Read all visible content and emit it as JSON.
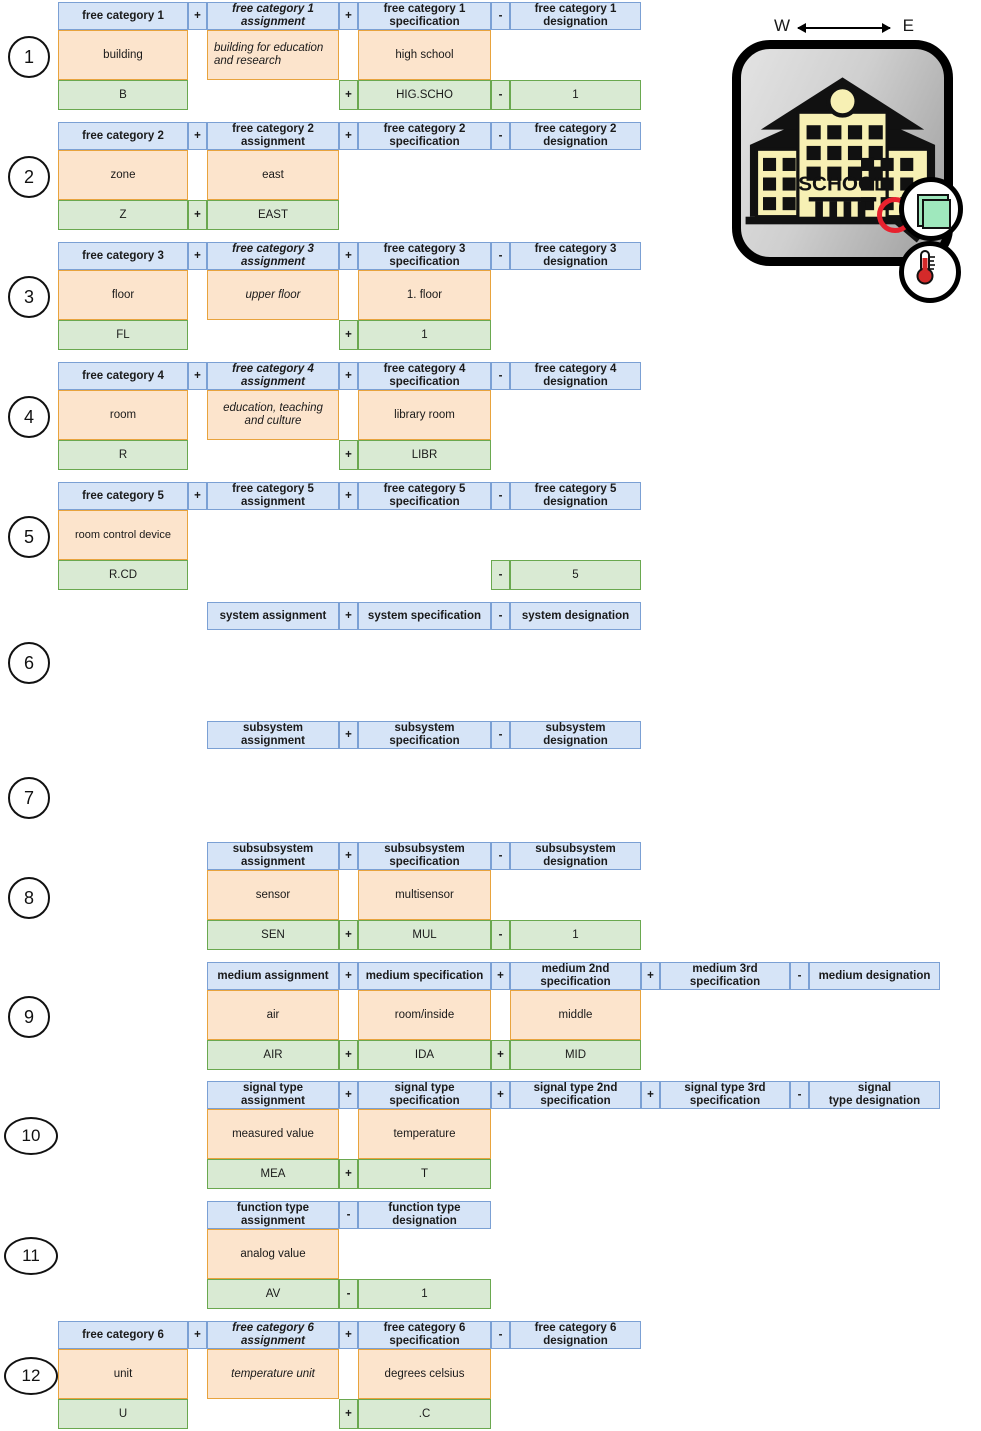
{
  "illustration": {
    "west_label": "W",
    "east_label": "E",
    "building_label": "SCHOOL",
    "badges": [
      {
        "name": "green-square-badge",
        "meaning": "room"
      },
      {
        "name": "thermometer-badge",
        "meaning": "temperature"
      }
    ],
    "magnifier": "magnifier-icon"
  },
  "blocks": [
    {
      "index": "1",
      "headers": [
        "free category 1",
        "+",
        "free category 1\nassignment",
        "+",
        "free category 1\nspecification",
        "-",
        "free category 1\ndesignation"
      ],
      "header_italic": [
        false,
        false,
        true,
        false,
        false,
        false,
        false
      ],
      "values": {
        "category": "building",
        "assignment": "building for education and research",
        "specification": "high school",
        "designation": ""
      },
      "value_italic": {
        "category": false,
        "assignment": true,
        "specification": false
      },
      "codes": {
        "category": "B",
        "op1": "",
        "assignment": "",
        "op2": "+",
        "specification": "HIG.SCHO",
        "op3": "-",
        "designation": "1"
      }
    },
    {
      "index": "2",
      "headers": [
        "free category 2",
        "+",
        "free category 2\nassignment",
        "+",
        "free category 2\nspecification",
        "-",
        "free category 2\ndesignation"
      ],
      "header_italic": [
        false,
        false,
        false,
        false,
        false,
        false,
        false
      ],
      "values": {
        "category": "zone",
        "assignment": "east",
        "specification": "",
        "designation": ""
      },
      "value_italic": {
        "category": false,
        "assignment": false,
        "specification": false
      },
      "codes": {
        "category": "Z",
        "op1": "+",
        "assignment": "EAST",
        "op2": "",
        "specification": "",
        "op3": "",
        "designation": ""
      }
    },
    {
      "index": "3",
      "headers": [
        "free category 3",
        "+",
        "free category 3\nassignment",
        "+",
        "free category 3\nspecification",
        "-",
        "free category 3\ndesignation"
      ],
      "header_italic": [
        false,
        false,
        true,
        false,
        false,
        false,
        false
      ],
      "values": {
        "category": "floor",
        "assignment": "upper floor",
        "specification": "1. floor",
        "designation": ""
      },
      "value_italic": {
        "category": false,
        "assignment": true,
        "specification": false
      },
      "codes": {
        "category": "FL",
        "op1": "",
        "assignment": "",
        "op2": "+",
        "specification": "1",
        "op3": "",
        "designation": ""
      }
    },
    {
      "index": "4",
      "headers": [
        "free category 4",
        "+",
        "free category 4\nassignment",
        "+",
        "free category 4\nspecification",
        "-",
        "free category 4\ndesignation"
      ],
      "header_italic": [
        false,
        false,
        true,
        false,
        false,
        false,
        false
      ],
      "values": {
        "category": "room",
        "assignment": "education, teaching and culture",
        "specification": "library room",
        "designation": ""
      },
      "value_italic": {
        "category": false,
        "assignment": true,
        "specification": false
      },
      "codes": {
        "category": "R",
        "op1": "",
        "assignment": "",
        "op2": "+",
        "specification": "LIBR",
        "op3": "",
        "designation": ""
      }
    },
    {
      "index": "5",
      "headers": [
        "free category 5",
        "+",
        "free category 5\nassignment",
        "+",
        "free category 5\nspecification",
        "-",
        "free category 5\ndesignation"
      ],
      "header_italic": [
        false,
        false,
        false,
        false,
        false,
        false,
        false
      ],
      "values": {
        "category": "room control device",
        "assignment": "",
        "specification": "",
        "designation": ""
      },
      "value_italic": {
        "category": false,
        "assignment": false,
        "specification": false
      },
      "codes": {
        "category": "R.CD",
        "op1": "",
        "assignment": "",
        "op2": "",
        "specification": "",
        "op3": "-",
        "designation": "5"
      }
    },
    {
      "index": "6",
      "headers": [
        "system assignment",
        "+",
        "system specification",
        "-",
        "system designation"
      ],
      "values": {
        "assignment": "",
        "specification": "",
        "designation": ""
      },
      "codes": {
        "assignment": "",
        "op1": "",
        "specification": "",
        "op2": "",
        "designation": ""
      }
    },
    {
      "index": "7",
      "headers": [
        "subsystem\nassignment",
        "+",
        "subsystem\nspecification",
        "-",
        "subsystem\ndesignation"
      ],
      "values": {
        "assignment": "",
        "specification": "",
        "designation": ""
      },
      "codes": {
        "assignment": "",
        "op1": "",
        "specification": "",
        "op2": "",
        "designation": ""
      }
    },
    {
      "index": "8",
      "headers": [
        "subsubsystem\nassignment",
        "+",
        "subsubsystem\nspecification",
        "-",
        "subsubsystem\ndesignation"
      ],
      "values": {
        "assignment": "sensor",
        "specification": "multisensor",
        "designation": ""
      },
      "codes": {
        "assignment": "SEN",
        "op1": "+",
        "specification": "MUL",
        "op2": "-",
        "designation": "1"
      }
    },
    {
      "index": "9",
      "headers": [
        "medium assignment",
        "+",
        "medium specification",
        "+",
        "medium 2nd\nspecification",
        "+",
        "medium 3rd\nspecification",
        "-",
        "medium designation"
      ],
      "values": {
        "assignment": "air",
        "specification": "room/inside",
        "spec2": "middle",
        "spec3": "",
        "designation": ""
      },
      "codes": {
        "assignment": "AIR",
        "op1": "+",
        "specification": "IDA",
        "op2": "+",
        "spec2": "MID",
        "op3": "",
        "spec3": "",
        "op4": "",
        "designation": ""
      }
    },
    {
      "index": "10",
      "headers": [
        "signal type\nassignment",
        "+",
        "signal type\nspecification",
        "+",
        "signal type 2nd\nspecification",
        "+",
        "signal type 3rd\nspecification",
        "-",
        "signal\ntype designation"
      ],
      "values": {
        "assignment": "measured value",
        "specification": "temperature",
        "spec2": "",
        "spec3": "",
        "designation": ""
      },
      "codes": {
        "assignment": "MEA",
        "op1": "+",
        "specification": "T",
        "op2": "",
        "spec2": "",
        "op3": "",
        "spec3": "",
        "op4": "",
        "designation": ""
      }
    },
    {
      "index": "11",
      "headers": [
        "function type\nassignment",
        "-",
        "function type\ndesignation"
      ],
      "values": {
        "assignment": "analog value",
        "designation": ""
      },
      "codes": {
        "assignment": "AV",
        "op1": "-",
        "designation": "1"
      }
    },
    {
      "index": "12",
      "headers": [
        "free category 6",
        "+",
        "free category 6\nassignment",
        "+",
        "free category 6\nspecification",
        "-",
        "free category 6\ndesignation"
      ],
      "header_italic": [
        false,
        false,
        true,
        false,
        false,
        false,
        false
      ],
      "values": {
        "category": "unit",
        "assignment": "temperature unit",
        "specification": "degrees celsius",
        "designation": ""
      },
      "value_italic": {
        "category": false,
        "assignment": true,
        "specification": false
      },
      "codes": {
        "category": "U",
        "op1": "",
        "assignment": "",
        "op2": "+",
        "specification": ".C",
        "op3": "",
        "designation": ""
      }
    }
  ],
  "colors": {
    "header_fill": "#d6e4f7",
    "header_border": "#7ba0d4",
    "value_fill": "#fce4cc",
    "value_border": "#e8a33d",
    "code_fill": "#d9ead3",
    "code_border": "#6aa84f",
    "accent_red": "#e8212e",
    "badge_green": "#9fe8bd"
  }
}
